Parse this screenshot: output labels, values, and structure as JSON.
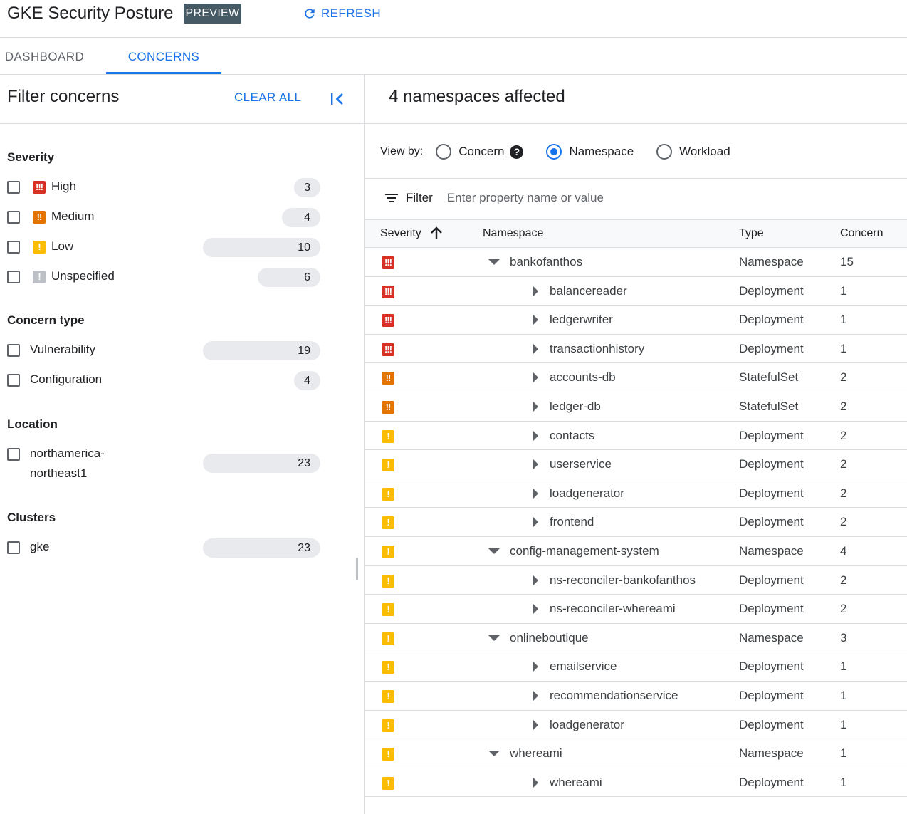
{
  "header": {
    "title": "GKE Security Posture",
    "badge": "PREVIEW",
    "refresh_label": "REFRESH",
    "refresh_icon": "refresh-icon"
  },
  "tabs": [
    {
      "label": "DASHBOARD",
      "active": false
    },
    {
      "label": "CONCERNS",
      "active": true
    }
  ],
  "filters": {
    "title": "Filter concerns",
    "clear_all": "CLEAR ALL",
    "collapse_icon": "collapse-panel-icon",
    "severity": {
      "heading": "Severity",
      "items": [
        {
          "label": "High",
          "icon": "!!!",
          "count": "3"
        },
        {
          "label": "Medium",
          "icon": "!!",
          "count": "4"
        },
        {
          "label": "Low",
          "icon": "!",
          "count": "10"
        },
        {
          "label": "Unspecified",
          "icon": "!",
          "count": "6"
        }
      ]
    },
    "concern_type": {
      "heading": "Concern type",
      "items": [
        {
          "label": "Vulnerability",
          "count": "19"
        },
        {
          "label": "Configuration",
          "count": "4"
        }
      ]
    },
    "location": {
      "heading": "Location",
      "items": [
        {
          "label_line1": "northamerica-",
          "label_line2": "northeast1",
          "count": "23"
        }
      ]
    },
    "clusters": {
      "heading": "Clusters",
      "items": [
        {
          "label": "gke",
          "count": "23"
        }
      ]
    }
  },
  "main": {
    "title": "4 namespaces affected",
    "view_by": {
      "label": "View by:",
      "options": [
        {
          "label": "Concern",
          "selected": false
        },
        {
          "label": "Namespace",
          "selected": true
        },
        {
          "label": "Workload",
          "selected": false
        }
      ],
      "help_icon": "?"
    },
    "filter": {
      "label": "Filter",
      "placeholder": "Enter property name or value"
    },
    "table": {
      "headers": [
        "Severity",
        "Namespace",
        "Type",
        "Concern"
      ],
      "sort_icon": "arrow-up-icon",
      "rows": [
        {
          "severity": "high",
          "sev_glyph": "!!!",
          "name": "bankofanthos",
          "type": "Namespace",
          "concern": "15",
          "level": 0,
          "expanded": true
        },
        {
          "severity": "high",
          "sev_glyph": "!!!",
          "name": "balancereader",
          "type": "Deployment",
          "concern": "1",
          "level": 1,
          "expanded": false
        },
        {
          "severity": "high",
          "sev_glyph": "!!!",
          "name": "ledgerwriter",
          "type": "Deployment",
          "concern": "1",
          "level": 1,
          "expanded": false
        },
        {
          "severity": "high",
          "sev_glyph": "!!!",
          "name": "transactionhistory",
          "type": "Deployment",
          "concern": "1",
          "level": 1,
          "expanded": false
        },
        {
          "severity": "medium",
          "sev_glyph": "!!",
          "name": "accounts-db",
          "type": "StatefulSet",
          "concern": "2",
          "level": 1,
          "expanded": false
        },
        {
          "severity": "medium",
          "sev_glyph": "!!",
          "name": "ledger-db",
          "type": "StatefulSet",
          "concern": "2",
          "level": 1,
          "expanded": false
        },
        {
          "severity": "low",
          "sev_glyph": "!",
          "name": "contacts",
          "type": "Deployment",
          "concern": "2",
          "level": 1,
          "expanded": false
        },
        {
          "severity": "low",
          "sev_glyph": "!",
          "name": "userservice",
          "type": "Deployment",
          "concern": "2",
          "level": 1,
          "expanded": false
        },
        {
          "severity": "low",
          "sev_glyph": "!",
          "name": "loadgenerator",
          "type": "Deployment",
          "concern": "2",
          "level": 1,
          "expanded": false
        },
        {
          "severity": "low",
          "sev_glyph": "!",
          "name": "frontend",
          "type": "Deployment",
          "concern": "2",
          "level": 1,
          "expanded": false
        },
        {
          "severity": "low",
          "sev_glyph": "!",
          "name": "config-management-system",
          "type": "Namespace",
          "concern": "4",
          "level": 0,
          "expanded": true
        },
        {
          "severity": "low",
          "sev_glyph": "!",
          "name": "ns-reconciler-bankofanthos",
          "type": "Deployment",
          "concern": "2",
          "level": 1,
          "expanded": false
        },
        {
          "severity": "low",
          "sev_glyph": "!",
          "name": "ns-reconciler-whereami",
          "type": "Deployment",
          "concern": "2",
          "level": 1,
          "expanded": false
        },
        {
          "severity": "low",
          "sev_glyph": "!",
          "name": "onlineboutique",
          "type": "Namespace",
          "concern": "3",
          "level": 0,
          "expanded": true
        },
        {
          "severity": "low",
          "sev_glyph": "!",
          "name": "emailservice",
          "type": "Deployment",
          "concern": "1",
          "level": 1,
          "expanded": false
        },
        {
          "severity": "low",
          "sev_glyph": "!",
          "name": "recommendationservice",
          "type": "Deployment",
          "concern": "1",
          "level": 1,
          "expanded": false
        },
        {
          "severity": "low",
          "sev_glyph": "!",
          "name": "loadgenerator",
          "type": "Deployment",
          "concern": "1",
          "level": 1,
          "expanded": false
        },
        {
          "severity": "low",
          "sev_glyph": "!",
          "name": "whereami",
          "type": "Namespace",
          "concern": "1",
          "level": 0,
          "expanded": true
        },
        {
          "severity": "low",
          "sev_glyph": "!",
          "name": "whereami",
          "type": "Deployment",
          "concern": "1",
          "level": 1,
          "expanded": false
        }
      ]
    }
  },
  "colors": {
    "accent": "#1a73e8",
    "high": "#d93025",
    "medium": "#e37400",
    "low": "#fbbc04",
    "unspecified": "#bdc1c6"
  }
}
